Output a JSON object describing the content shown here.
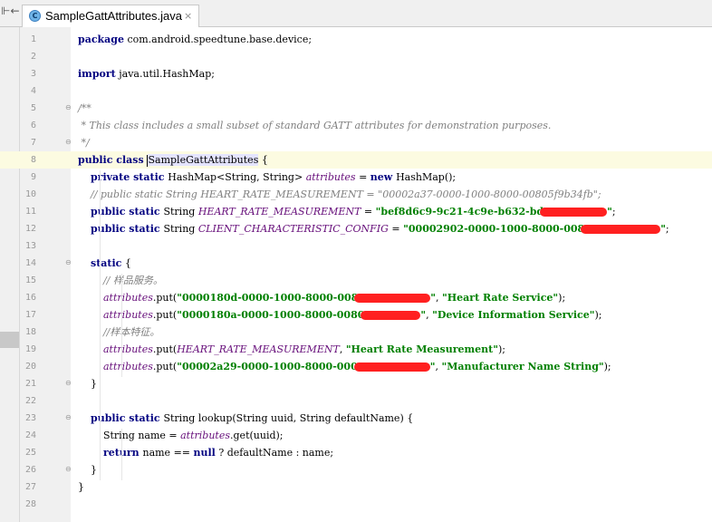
{
  "tab": {
    "title": "SampleGattAttributes.java",
    "icon_letter": "C",
    "close_glyph": "×",
    "left_tool_glyph": "⊩←"
  },
  "lines": [
    {
      "n": "1",
      "tokens": [
        [
          "kw",
          "package"
        ],
        [
          "nm",
          " com.android.speedtune.base.device;"
        ]
      ]
    },
    {
      "n": "2",
      "tokens": []
    },
    {
      "n": "3",
      "tokens": [
        [
          "kw",
          "import"
        ],
        [
          "nm",
          " java.util.HashMap;"
        ]
      ]
    },
    {
      "n": "4",
      "tokens": []
    },
    {
      "n": "5",
      "fold": "⊖",
      "tokens": [
        [
          "cm",
          "/**"
        ]
      ]
    },
    {
      "n": "6",
      "tokens": [
        [
          "cm",
          " * This class includes a small subset of standard GATT attributes for demonstration purposes."
        ]
      ]
    },
    {
      "n": "7",
      "fold": "⊖",
      "tokens": [
        [
          "cm",
          " */"
        ]
      ]
    },
    {
      "n": "8",
      "current": true,
      "tokens": [
        [
          "kw",
          "public class "
        ],
        [
          "caret",
          ""
        ],
        [
          "sel",
          "SampleGattAttributes"
        ],
        [
          "nm",
          " {"
        ]
      ]
    },
    {
      "n": "9",
      "tokens": [
        [
          "nm",
          "    "
        ],
        [
          "kw",
          "private static "
        ],
        [
          "nm",
          "HashMap<String, String> "
        ],
        [
          "fld",
          "attributes"
        ],
        [
          "nm",
          " = "
        ],
        [
          "kw",
          "new "
        ],
        [
          "nm",
          "HashMap();"
        ]
      ]
    },
    {
      "n": "10",
      "tokens": [
        [
          "cm",
          "    // public static String HEART_RATE_MEASUREMENT = \"00002a37-0000-1000-8000-00805f9b34fb\";"
        ]
      ]
    },
    {
      "n": "11",
      "tokens": [
        [
          "nm",
          "    "
        ],
        [
          "kw",
          "public static "
        ],
        [
          "nm",
          "String "
        ],
        [
          "fld",
          "HEART_RATE_MEASUREMENT"
        ],
        [
          "nm",
          " = "
        ],
        [
          "str",
          "\"bef8d6c9-9c21-4c9e-b632-bd"
        ],
        [
          "redact",
          "74"
        ],
        [
          "str",
          "\""
        ],
        [
          "nm",
          ";"
        ]
      ]
    },
    {
      "n": "12",
      "tokens": [
        [
          "nm",
          "    "
        ],
        [
          "kw",
          "public static "
        ],
        [
          "nm",
          "String "
        ],
        [
          "fld",
          "CLIENT_CHARACTERISTIC_CONFIG"
        ],
        [
          "nm",
          " = "
        ],
        [
          "str",
          "\"00002902-0000-1000-8000-008"
        ],
        [
          "redact",
          "88"
        ],
        [
          "str",
          "\""
        ],
        [
          "nm",
          ";"
        ]
      ]
    },
    {
      "n": "13",
      "tokens": []
    },
    {
      "n": "14",
      "fold": "⊖",
      "tokens": [
        [
          "nm",
          "    "
        ],
        [
          "kw",
          "static"
        ],
        [
          "nm",
          " {"
        ]
      ]
    },
    {
      "n": "15",
      "tokens": [
        [
          "cm",
          "        // "
        ],
        [
          "cm",
          "样品服务。"
        ]
      ]
    },
    {
      "n": "16",
      "tokens": [
        [
          "nm",
          "        "
        ],
        [
          "fld",
          "attributes"
        ],
        [
          "nm",
          ".put("
        ],
        [
          "str",
          "\"0000180d-0000-1000-8000-008"
        ],
        [
          "redact",
          "84"
        ],
        [
          "str",
          "\""
        ],
        [
          "nm",
          ", "
        ],
        [
          "str",
          "\"Heart Rate Service\""
        ],
        [
          "nm",
          ");"
        ]
      ]
    },
    {
      "n": "17",
      "tokens": [
        [
          "nm",
          "        "
        ],
        [
          "fld",
          "attributes"
        ],
        [
          "nm",
          ".put("
        ],
        [
          "str",
          "\"0000180a-0000-1000-8000-0080"
        ],
        [
          "redact",
          "66"
        ],
        [
          "str",
          "\""
        ],
        [
          "nm",
          ", "
        ],
        [
          "str",
          "\"Device Information Service\""
        ],
        [
          "nm",
          ");"
        ]
      ]
    },
    {
      "n": "18",
      "tokens": [
        [
          "cm",
          "        //"
        ],
        [
          "cm",
          "样本特征。"
        ]
      ]
    },
    {
      "n": "19",
      "tokens": [
        [
          "nm",
          "        "
        ],
        [
          "fld",
          "attributes"
        ],
        [
          "nm",
          ".put("
        ],
        [
          "fld",
          "HEART_RATE_MEASUREMENT"
        ],
        [
          "nm",
          ", "
        ],
        [
          "str",
          "\"Heart Rate Measurement\""
        ],
        [
          "nm",
          ");"
        ]
      ]
    },
    {
      "n": "20",
      "tokens": [
        [
          "nm",
          "        "
        ],
        [
          "fld",
          "attributes"
        ],
        [
          "nm",
          ".put("
        ],
        [
          "str",
          "\"00002a29-0000-1000-8000-000"
        ],
        [
          "redact",
          "84"
        ],
        [
          "str",
          "\""
        ],
        [
          "nm",
          ", "
        ],
        [
          "str",
          "\"Manufacturer Name String\""
        ],
        [
          "nm",
          ");"
        ]
      ]
    },
    {
      "n": "21",
      "fold": "⊖",
      "tokens": [
        [
          "nm",
          "    }"
        ]
      ]
    },
    {
      "n": "22",
      "tokens": []
    },
    {
      "n": "23",
      "fold": "⊖",
      "tokens": [
        [
          "nm",
          "    "
        ],
        [
          "kw",
          "public static "
        ],
        [
          "nm",
          "String "
        ],
        [
          "mth",
          "lookup"
        ],
        [
          "nm",
          "(String uuid, String defaultName) {"
        ]
      ]
    },
    {
      "n": "24",
      "tokens": [
        [
          "nm",
          "        String name = "
        ],
        [
          "fld",
          "attributes"
        ],
        [
          "nm",
          ".get(uuid);"
        ]
      ]
    },
    {
      "n": "25",
      "tokens": [
        [
          "nm",
          "        "
        ],
        [
          "kw",
          "return "
        ],
        [
          "nm",
          "name == "
        ],
        [
          "kw",
          "null"
        ],
        [
          "nm",
          " ? defaultName : name;"
        ]
      ]
    },
    {
      "n": "26",
      "fold": "⊖",
      "tokens": [
        [
          "nm",
          "    }"
        ]
      ]
    },
    {
      "n": "27",
      "tokens": [
        [
          "nm",
          "}"
        ]
      ]
    },
    {
      "n": "28",
      "tokens": []
    }
  ]
}
